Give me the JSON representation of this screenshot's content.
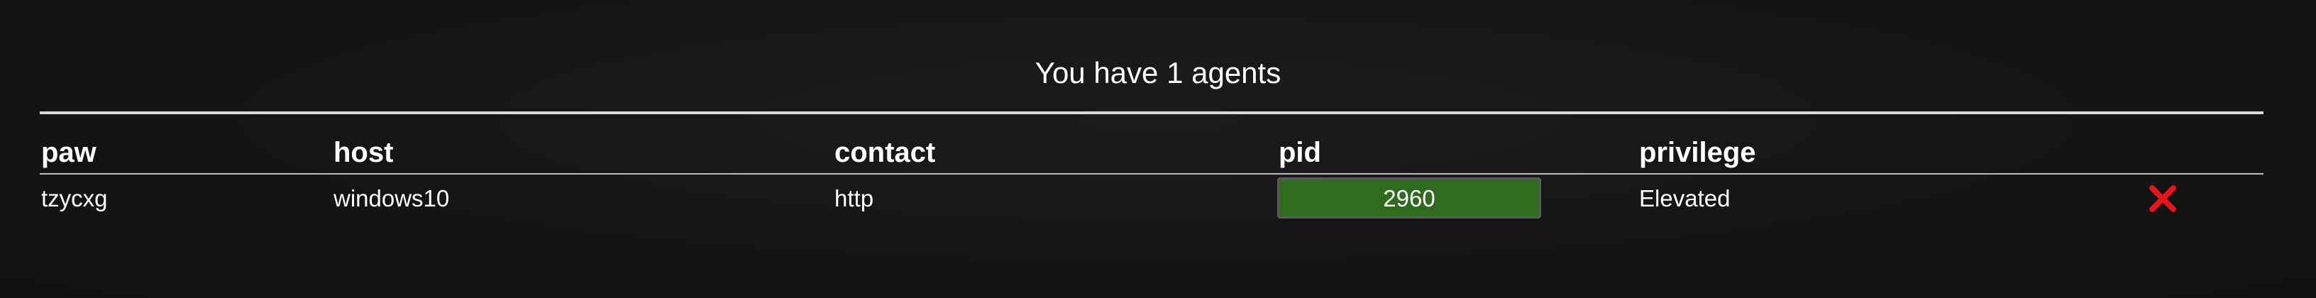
{
  "summary": "You have 1 agents",
  "table": {
    "headers": [
      "paw",
      "host",
      "contact",
      "pid",
      "privilege"
    ],
    "rows": [
      {
        "paw": "tzycxg",
        "host": "windows10",
        "contact": "http",
        "pid": "2960",
        "privilege": "Elevated",
        "action_icon": "close-icon"
      }
    ]
  },
  "colors": {
    "pid_button": "#2f6b1c",
    "delete_icon": "#e8141c",
    "background": "#151515"
  }
}
